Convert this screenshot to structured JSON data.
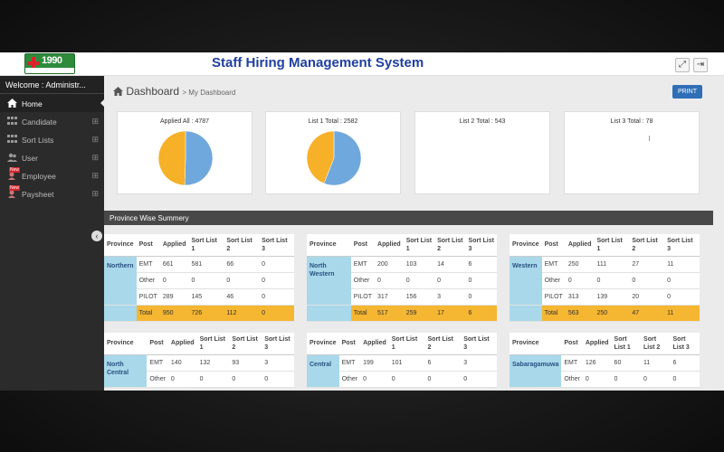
{
  "app": {
    "title": "Staff Hiring Management System",
    "logo_text": "1990"
  },
  "sidebar": {
    "welcome": "Welcome : Administr...",
    "items": [
      {
        "label": "Home",
        "icon": "home-icon"
      },
      {
        "label": "Candidate",
        "icon": "grid-icon"
      },
      {
        "label": "Sort Lists",
        "icon": "grid-icon"
      },
      {
        "label": "User",
        "icon": "users-icon"
      },
      {
        "label": "Employee",
        "icon": "employee-icon",
        "badge": "New"
      },
      {
        "label": "Paysheet",
        "icon": "paysheet-icon",
        "badge": "New"
      }
    ]
  },
  "page": {
    "title": "Dashboard",
    "breadcrumb": "> My Dashboard",
    "print_label": "PRINT"
  },
  "cards": [
    {
      "title": "Applied All :  4787"
    },
    {
      "title": "List 1 Total :  2582"
    },
    {
      "title": "List 2 Total :  543"
    },
    {
      "title": "List 3 Total :  78"
    }
  ],
  "chart_data": [
    {
      "type": "pie",
      "title": "Applied All :  4787",
      "values": [
        50.5,
        49.5
      ],
      "colors": [
        "#6fa8dc",
        "#f6b128"
      ]
    },
    {
      "type": "pie",
      "title": "List 1 Total :  2582",
      "values": [
        56,
        44
      ],
      "colors": [
        "#6fa8dc",
        "#f6b128"
      ]
    }
  ],
  "section": {
    "title": "Province Wise Summery"
  },
  "table_headers": [
    "Province",
    "Post",
    "Applied",
    "Sort List 1",
    "Sort List 2",
    "Sort List 3"
  ],
  "provinces": [
    {
      "name": "Northern",
      "rows": [
        [
          "EMT",
          "661",
          "581",
          "66",
          "0"
        ],
        [
          "Other",
          "0",
          "0",
          "0",
          "0"
        ],
        [
          "PILOT",
          "289",
          "145",
          "46",
          "0"
        ]
      ],
      "total": [
        "Total",
        "950",
        "726",
        "112",
        "0"
      ]
    },
    {
      "name": "North Western",
      "rows": [
        [
          "EMT",
          "200",
          "103",
          "14",
          "6"
        ],
        [
          "Other",
          "0",
          "0",
          "0",
          "0"
        ],
        [
          "PILOT",
          "317",
          "156",
          "3",
          "0"
        ]
      ],
      "total": [
        "Total",
        "517",
        "259",
        "17",
        "6"
      ]
    },
    {
      "name": "Western",
      "rows": [
        [
          "EMT",
          "250",
          "111",
          "27",
          "11"
        ],
        [
          "Other",
          "0",
          "0",
          "0",
          "0"
        ],
        [
          "PILOT",
          "313",
          "139",
          "20",
          "0"
        ]
      ],
      "total": [
        "Total",
        "563",
        "250",
        "47",
        "11"
      ]
    },
    {
      "name": "North Central",
      "rows": [
        [
          "EMT",
          "140",
          "132",
          "93",
          "3"
        ],
        [
          "Other",
          "0",
          "0",
          "0",
          "0"
        ]
      ]
    },
    {
      "name": "Central",
      "rows": [
        [
          "EMT",
          "199",
          "101",
          "6",
          "3"
        ],
        [
          "Other",
          "0",
          "0",
          "0",
          "0"
        ]
      ]
    },
    {
      "name": "Sabaragamuwa",
      "rows": [
        [
          "EMT",
          "126",
          "60",
          "11",
          "6"
        ],
        [
          "Other",
          "0",
          "0",
          "0",
          "0"
        ]
      ]
    }
  ]
}
